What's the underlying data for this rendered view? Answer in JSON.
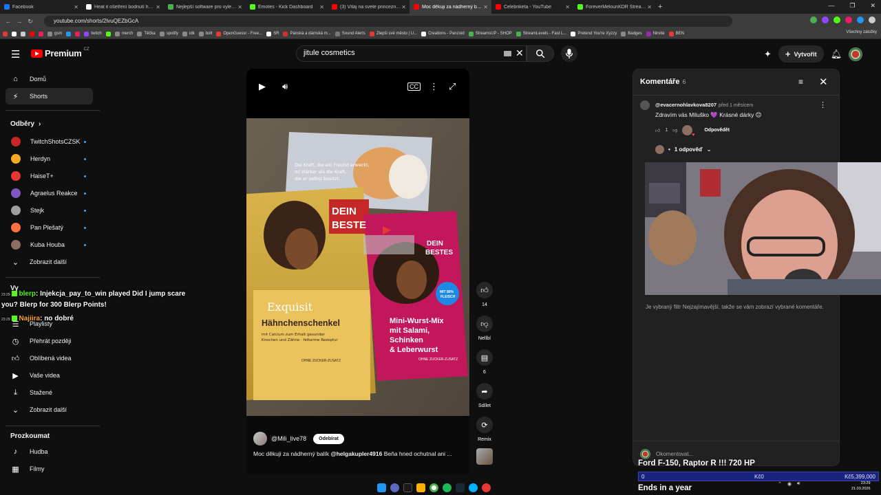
{
  "browser": {
    "tabs": [
      {
        "title": "Facebook",
        "color": "#1877f2"
      },
      {
        "title": "Heat it ošetření bodnutí hmyzem",
        "color": "#ffffff"
      },
      {
        "title": "Nejlepší software pro vylepšení",
        "color": "#4caf50"
      },
      {
        "title": "Emotes - Kick Dashboard",
        "color": "#53fc18"
      },
      {
        "title": "(3) Vítaj na svete princezná! Dr",
        "color": "#ff0000"
      },
      {
        "title": "Moc děkuji za nádherný balík @",
        "color": "#ff0000",
        "active": true
      },
      {
        "title": "Celebriketa - YouTube",
        "color": "#ff0000"
      },
      {
        "title": "ForeverMelounKDR Stream - W",
        "color": "#53fc18"
      }
    ],
    "new_tab": "+",
    "url": "youtube.com/shorts/2lvuQEZbGcA",
    "bookmarks": [
      {
        "label": "",
        "color": "#e53935"
      },
      {
        "label": "",
        "color": "#ffffff"
      },
      {
        "label": "",
        "color": "#cccccc"
      },
      {
        "label": "",
        "color": "#ff0000"
      },
      {
        "label": "",
        "color": "#e91e63"
      },
      {
        "label": "gsm",
        "color": "#888888"
      },
      {
        "label": "",
        "color": "#2196f3"
      },
      {
        "label": "",
        "color": "#e91e63"
      },
      {
        "label": "twitch",
        "color": "#9146ff"
      },
      {
        "label": "",
        "color": "#53fc18"
      },
      {
        "label": "merch",
        "color": "#888888"
      },
      {
        "label": "Těčka",
        "color": "#888888"
      },
      {
        "label": "spotify",
        "color": "#888888"
      },
      {
        "label": "idk",
        "color": "#888888"
      },
      {
        "label": "bolt",
        "color": "#888888"
      },
      {
        "label": "OpenGuessr - Free...",
        "color": "#e53935"
      },
      {
        "label": "SR",
        "color": "#ffffff"
      },
      {
        "label": "Pánská a dámská m...",
        "color": "#d32f2f"
      },
      {
        "label": "Sound Alerts",
        "color": "#777777"
      },
      {
        "label": "Zlepši své město | U...",
        "color": "#e53935"
      },
      {
        "label": "Creations - Panzoid",
        "color": "#ffffff"
      },
      {
        "label": "StreamsUP - SHOP",
        "color": "#4caf50"
      },
      {
        "label": "StreamLevels - Fast L...",
        "color": "#4caf50"
      },
      {
        "label": "Pretend You're Xyzzy",
        "color": "#ffffff"
      },
      {
        "label": "Badges",
        "color": "#888888"
      },
      {
        "label": "Nirvite",
        "color": "#9c27b0"
      },
      {
        "label": "BEN",
        "color": "#e53935"
      }
    ],
    "all_bookmarks": "Všechny záložky"
  },
  "youtube": {
    "logo": "Premium",
    "logo_country": "CZ",
    "search_value": "jitule cosmetics",
    "create_label": "Vytvořit"
  },
  "sidebar": {
    "top": [
      {
        "label": "Domů",
        "icon": "home-icon"
      },
      {
        "label": "Shorts",
        "icon": "shorts-icon",
        "active": true
      }
    ],
    "subs_header": "Odběry",
    "subscriptions": [
      {
        "label": "TwitchShotsCZSK",
        "color": "#c62828"
      },
      {
        "label": "Herdyn",
        "color": "#f9a825"
      },
      {
        "label": "HaiseT+",
        "color": "#e53935"
      },
      {
        "label": "Agraelus Reakce",
        "color": "#7e57c2"
      },
      {
        "label": "Stejk",
        "color": "#9e9e9e"
      },
      {
        "label": "Pan Plešatý",
        "color": "#ff7043"
      },
      {
        "label": "Kuba Houba",
        "color": "#8d6e63"
      }
    ],
    "show_more": "Zobrazit další",
    "you_header": "Vy",
    "you_items": [
      {
        "label": "Playlisty",
        "icon": "playlist-icon"
      },
      {
        "label": "Přehrát později",
        "icon": "watch-later-icon"
      },
      {
        "label": "Oblíbená videa",
        "icon": "like-icon"
      },
      {
        "label": "Vaše videa",
        "icon": "your-videos-icon"
      },
      {
        "label": "Stažené",
        "icon": "download-icon"
      }
    ],
    "show_more_2": "Zobrazit další",
    "explore_header": "Prozkoumat",
    "explore_items": [
      {
        "label": "Hudba",
        "icon": "music-icon"
      },
      {
        "label": "Filmy",
        "icon": "film-icon"
      }
    ]
  },
  "chat_overlay": [
    {
      "time": "23:29",
      "user": "blerp",
      "user_color": "#53fc18",
      "message": ": Injekcja_pay_to_win played Did I jump scare"
    },
    {
      "time": "",
      "user": "",
      "user_color": "#ffffff",
      "message": "you? Blerp for 300 Blerp Points!"
    },
    {
      "time": "23:29",
      "user": "Najiira",
      "user_color": "#ffa726",
      "message": ": no dobré"
    }
  ],
  "short": {
    "channel": "@Mili_live78",
    "subscribe": "Odebírat",
    "title_start": "Moc děkuji za nádherný balík ",
    "title_mention": "@helgakupler4916",
    "title_end": " Beňa hned ochutnal ani ...",
    "actions": [
      {
        "label": "14",
        "icon": "thumb-up-icon"
      },
      {
        "label": "Nelíbí",
        "icon": "thumb-down-icon"
      },
      {
        "label": "6",
        "icon": "comment-icon"
      },
      {
        "label": "Sdílet",
        "icon": "share-icon"
      },
      {
        "label": "Remix",
        "icon": "remix-icon"
      }
    ],
    "product_texts": {
      "poster": "Die Kraft, die ein Freund erweckt, ist stärker als die Kraft, die er selbst besitzt.",
      "brand": "DEIN BESTES",
      "left_brand": "Exquisit",
      "left_product": "Hähnchenschenkel",
      "left_desc": "mit Calcium zum Erhalt gesunder Knochen und Zähne · fettarme Rezeptur",
      "right_product": "Mini-Wurst-Mix mit Salami, Schinken & Leberwurst",
      "badge": "MIT 80% FLEISCH",
      "sugar": "OHNE ZUCKER-ZUSATZ"
    }
  },
  "comments": {
    "title": "Komentáře",
    "count": "6",
    "first": {
      "user": "@evacernohlavkova8207",
      "time": "před 1 měsícem",
      "text": "Zdravím vás Miluško 💜 Krásné dárky 😊",
      "likes": "1",
      "reply": "Odpovědět"
    },
    "replies": "1 odpověď",
    "filter_note": "Je vybraný filtr Nejzajímavější, takže se vám zobrazí vybrané komentáře.",
    "add_placeholder": "Okomentovat..."
  },
  "stream_overlay": {
    "headline": "Ford F-150, Raptor R !!! 720 HP",
    "progress_start": "0",
    "progress_mid": "Kč0",
    "progress_goal": "Kč5,399,000",
    "progress_fraction": 0,
    "footer": "Ends in a year"
  },
  "taskbar": {
    "time": "23:29",
    "date": "21.03.2026"
  }
}
